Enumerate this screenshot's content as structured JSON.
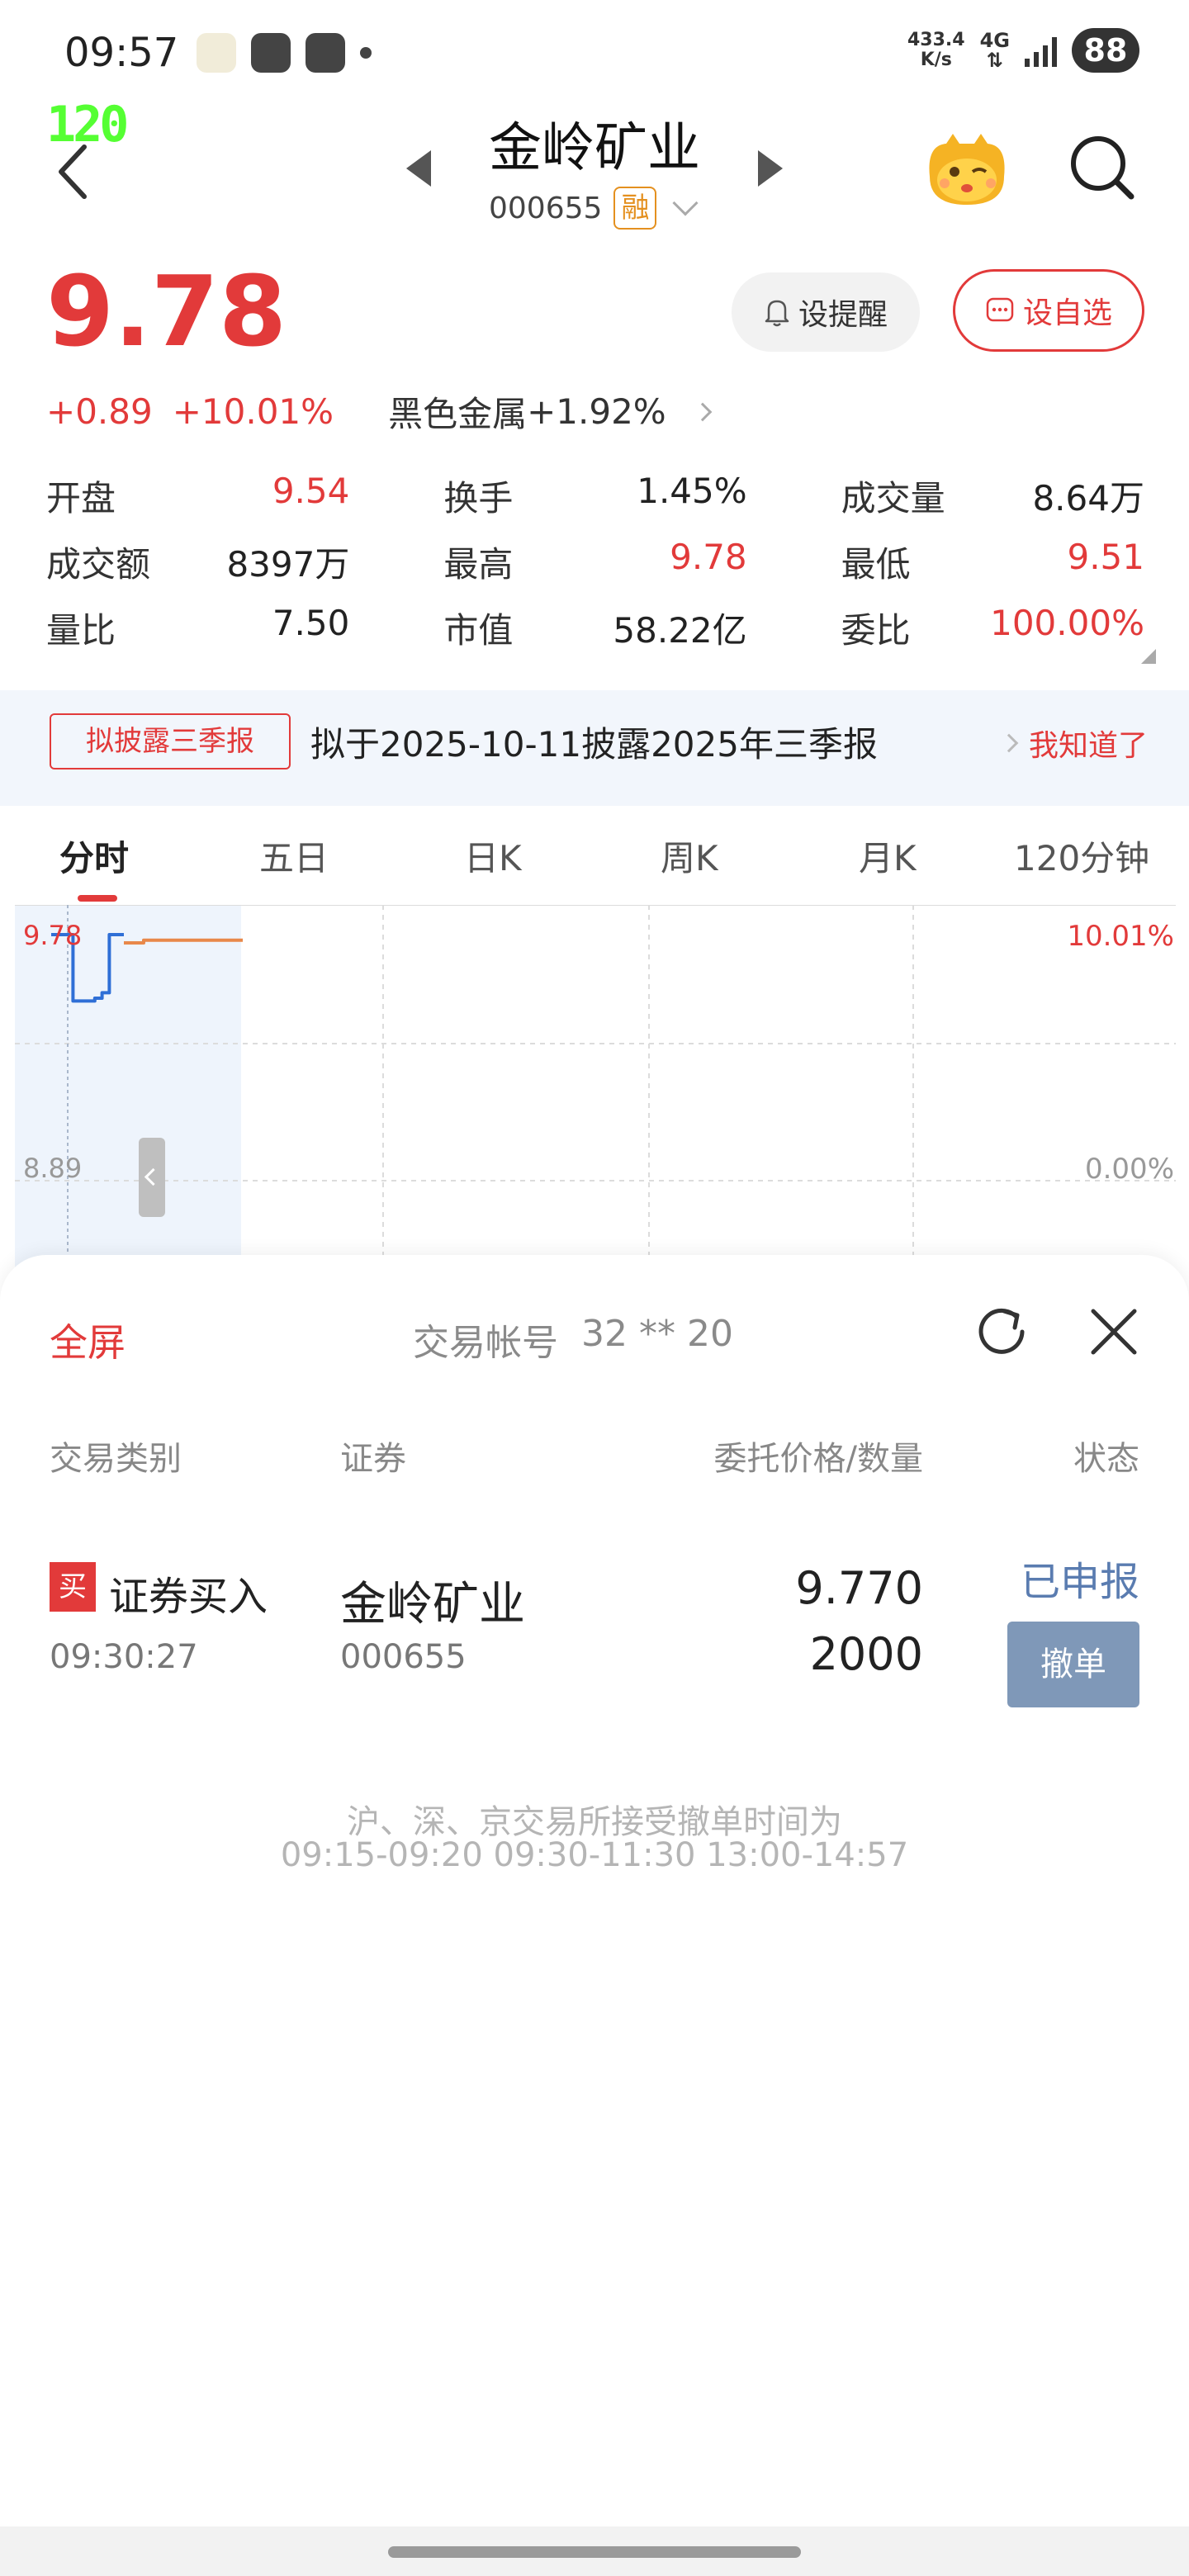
{
  "status_bar": {
    "time": "09:57",
    "net_speed": "433.4",
    "net_unit": "K/s",
    "network": "4G",
    "battery": "88"
  },
  "overlay": {
    "fps": "120"
  },
  "nav": {
    "stock_name": "金岭矿业",
    "stock_code": "000655",
    "margin_badge": "融"
  },
  "quote": {
    "price": "9.78",
    "change": "+0.89",
    "change_pct": "+10.01%",
    "industry": "黑色金属",
    "industry_pct": "+1.92%",
    "remind_label": "设提醒",
    "favorite_label": "设自选",
    "colors": {
      "up": "#e23a3a",
      "tag": "#e4901f"
    }
  },
  "stats": {
    "open_label": "开盘",
    "open": "9.54",
    "turnover_label": "换手",
    "turnover": "1.45%",
    "volume_label": "成交量",
    "volume": "8.64万",
    "amount_label": "成交额",
    "amount": "8397万",
    "high_label": "最高",
    "high": "9.78",
    "low_label": "最低",
    "low": "9.51",
    "vol_ratio_label": "量比",
    "vol_ratio": "7.50",
    "mcap_label": "市值",
    "mcap": "58.22亿",
    "bid_ratio_label": "委比",
    "bid_ratio": "100.00%"
  },
  "notice": {
    "badge": "拟披露三季报",
    "text": "拟于2025-10-11披露2025年三季报",
    "dismiss": "我知道了"
  },
  "tabs": [
    "分时",
    "五日",
    "日K",
    "周K",
    "月K",
    "120分钟"
  ],
  "chart": {
    "price_top": "9.78",
    "price_base": "8.89",
    "pct_top": "10.01%",
    "pct_base": "0.00%"
  },
  "chart_data": {
    "type": "line",
    "y_range": [
      8.89,
      9.78
    ],
    "series": [
      {
        "values": [
          9.78,
          9.78,
          9.78,
          9.54,
          9.54,
          9.54,
          9.55,
          9.57,
          9.78,
          9.78,
          9.78
        ]
      },
      {
        "values": [
          9.75,
          9.76,
          9.76,
          9.76,
          9.76,
          9.76,
          9.76
        ]
      }
    ],
    "colors": [
      "#2f6fd6",
      "#e8884a"
    ]
  },
  "sheet": {
    "fullscreen": "全屏",
    "account_label": "交易帐号",
    "account_no": "32 ** 20",
    "headers": {
      "type": "交易类别",
      "security": "证券",
      "price_qty": "委托价格/数量",
      "status": "状态"
    },
    "order": {
      "side_badge": "买",
      "type": "证券买入",
      "time": "09:30:27",
      "name": "金岭矿业",
      "code": "000655",
      "price": "9.770",
      "qty": "2000",
      "status": "已申报",
      "cancel": "撤单"
    },
    "info_line1": "沪、深、京交易所接受撤单时间为",
    "info_line2": "09:15-09:20 09:30-11:30 13:00-14:57"
  }
}
